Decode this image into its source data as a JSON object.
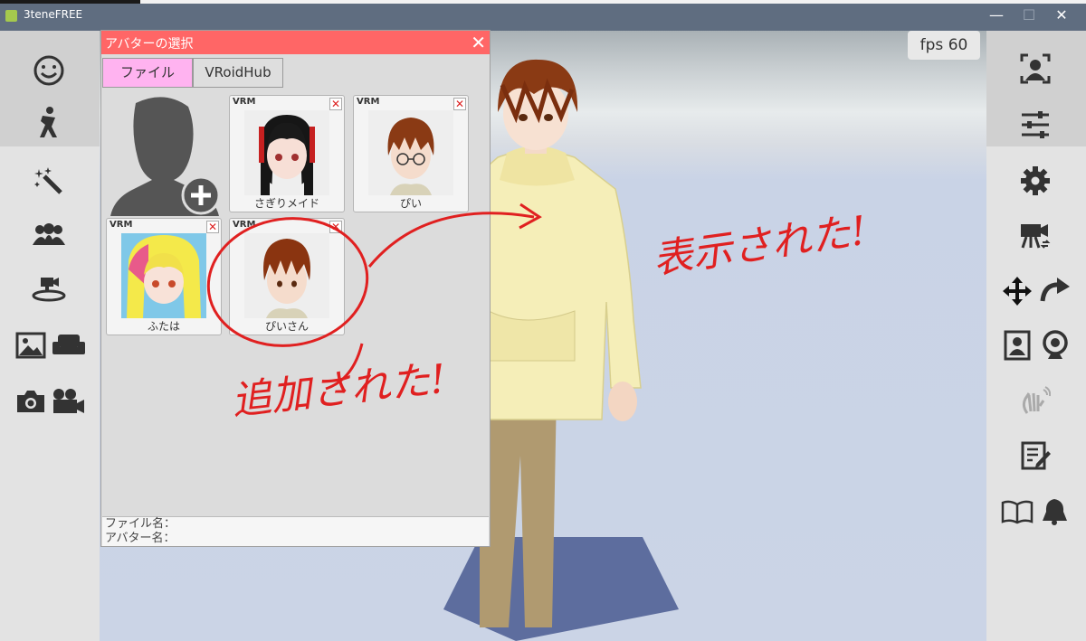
{
  "window": {
    "title": "3teneFREE",
    "minimize": "—",
    "maximize": "☐",
    "close": "✕"
  },
  "fps": {
    "text": "fps  60"
  },
  "dialog": {
    "title": "アバターの選択",
    "close": "✕",
    "tabs": [
      {
        "label": "ファイル"
      },
      {
        "label": "VRoidHub"
      }
    ],
    "cards": [
      {
        "badge": "VRM",
        "delete": "✕",
        "name": "さぎりメイド"
      },
      {
        "badge": "VRM",
        "delete": "✕",
        "name": "ぴい"
      },
      {
        "badge": "VRM",
        "delete": "✕",
        "name": "ふたは"
      },
      {
        "badge": "VRM",
        "delete": "✕",
        "name": "ぴいさん"
      }
    ],
    "info": {
      "file_label": "ファイル名：",
      "avatar_label": "アバター名："
    }
  },
  "annotations": {
    "added": "追加された!",
    "shown": "表示された!"
  },
  "left_icons": [
    "face-icon",
    "pose-icon",
    "effects-wand-icon",
    "group-icon",
    "camera-stage-icon",
    "background-image-icon",
    "sofa-icon",
    "camera-icon",
    "movie-camera-icon"
  ],
  "right_icons": [
    "face-tracking-icon",
    "sliders-icon",
    "gear-icon",
    "video-camera-icon",
    "move-arrows-icon",
    "redo-arrow-icon",
    "portrait-icon",
    "webcam-icon",
    "hand-wave-icon",
    "edit-icon",
    "book-icon",
    "bell-icon"
  ],
  "colors": {
    "accent": "#ff6666",
    "tab_active": "#ffb3f0",
    "annotation": "#e02020"
  }
}
